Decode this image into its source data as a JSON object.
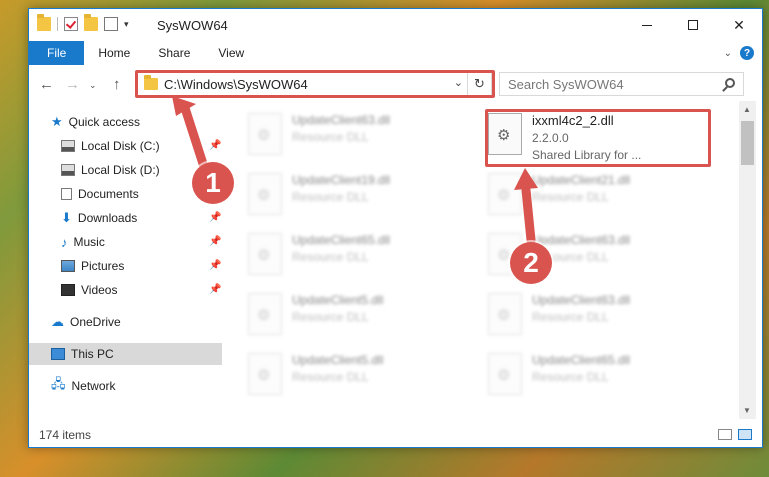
{
  "window": {
    "title": "SysWOW64"
  },
  "ribbon": {
    "tabs": [
      "File",
      "Home",
      "Share",
      "View"
    ]
  },
  "address": {
    "path": "C:\\Windows\\SysWOW64"
  },
  "search": {
    "placeholder": "Search SysWOW64"
  },
  "sidebar": {
    "items": [
      {
        "label": "Quick access",
        "icon": "star-icon",
        "pinned": false
      },
      {
        "label": "Local Disk (C:)",
        "icon": "disk-icon",
        "pinned": true
      },
      {
        "label": "Local Disk (D:)",
        "icon": "disk-icon",
        "pinned": false
      },
      {
        "label": "Documents",
        "icon": "documents-icon",
        "pinned": false
      },
      {
        "label": "Downloads",
        "icon": "download-icon",
        "pinned": true
      },
      {
        "label": "Music",
        "icon": "music-icon",
        "pinned": true
      },
      {
        "label": "Pictures",
        "icon": "pictures-icon",
        "pinned": true
      },
      {
        "label": "Videos",
        "icon": "videos-icon",
        "pinned": true
      },
      {
        "label": "OneDrive",
        "icon": "cloud-icon",
        "pinned": false
      },
      {
        "label": "This PC",
        "icon": "pc-icon",
        "pinned": false,
        "selected": true
      },
      {
        "label": "Network",
        "icon": "network-icon",
        "pinned": false
      }
    ]
  },
  "files": {
    "highlighted": {
      "name": "ixxml4c2_2.dll",
      "version": "2.2.0.0",
      "desc": "Shared Library for ..."
    },
    "blurred": [
      {
        "name": "UpdateClient63.dll",
        "desc": "Resource DLL"
      },
      {
        "name": "UpdateClient19.dll",
        "desc": "Resource DLL"
      },
      {
        "name": "UpdateClient21.dll",
        "desc": "Resource DLL"
      },
      {
        "name": "UpdateClient65.dll",
        "desc": "Resource DLL"
      },
      {
        "name": "UpdateClient63.dll",
        "desc": "Resource DLL"
      },
      {
        "name": "UpdateClient5.dll",
        "desc": "Resource DLL"
      },
      {
        "name": "UpdateClient63.dll",
        "desc": "Resource DLL"
      },
      {
        "name": "UpdateClient5.dll",
        "desc": "Resource DLL"
      },
      {
        "name": "UpdateClient65.dll",
        "desc": "Resource DLL"
      }
    ]
  },
  "status": {
    "count": "174 items"
  },
  "annotations": {
    "step1": "1",
    "step2": "2",
    "color": "#d9534f"
  }
}
